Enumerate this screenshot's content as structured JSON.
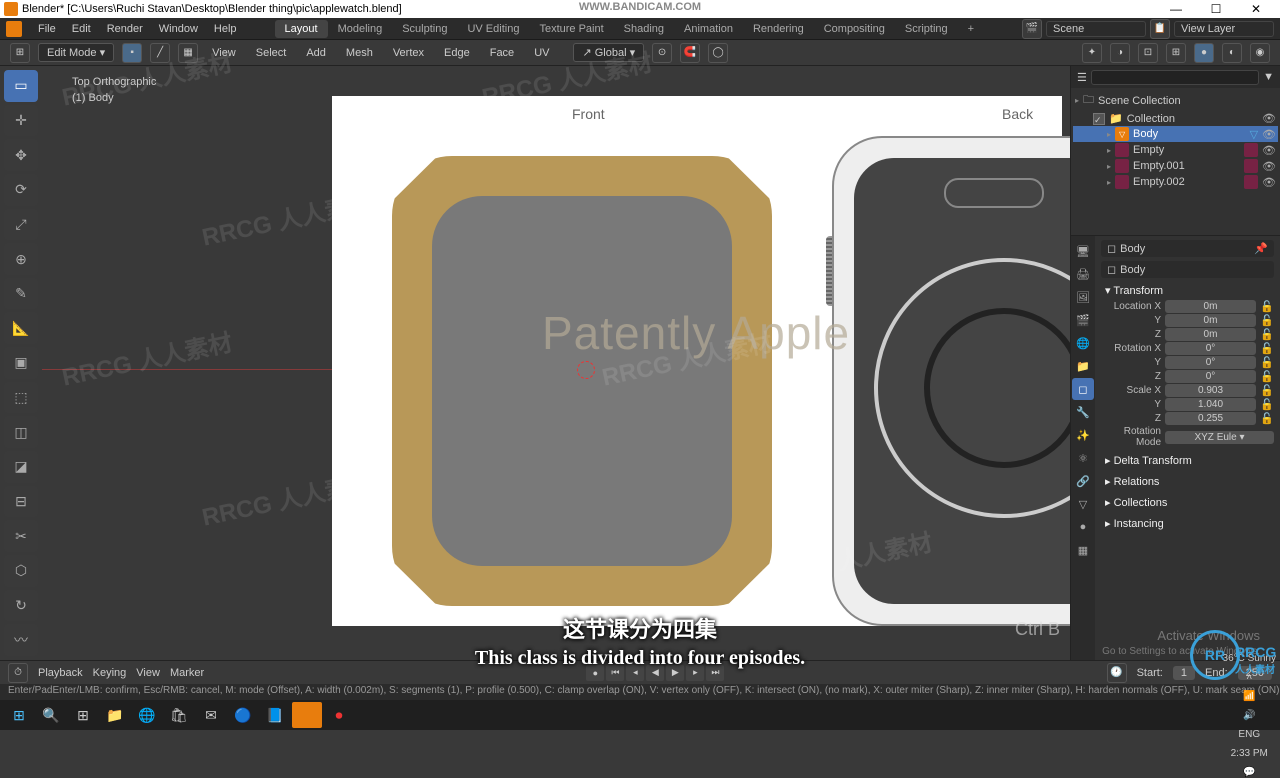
{
  "titlebar": {
    "app_title": "Blender* [C:\\Users\\Ruchi Stavan\\Desktop\\Blender thing\\pic\\applewatch.blend]",
    "bandicam": "WWW.BANDICAM.COM"
  },
  "menubar": {
    "items": [
      "File",
      "Edit",
      "Render",
      "Window",
      "Help"
    ],
    "tabs": [
      "Layout",
      "Modeling",
      "Sculpting",
      "UV Editing",
      "Texture Paint",
      "Shading",
      "Animation",
      "Rendering",
      "Compositing",
      "Scripting"
    ],
    "active_tab": "Layout",
    "scene_icon_label": "Scene",
    "viewlayer_label": "View Layer"
  },
  "toolbar2": {
    "mode": "Edit Mode",
    "menus": [
      "View",
      "Select",
      "Add",
      "Mesh",
      "Vertex",
      "Edge",
      "Face",
      "UV"
    ],
    "orientation": "Global"
  },
  "viewport": {
    "view_name": "Top Orthographic",
    "object_name": "(1) Body",
    "ref_front": "Front",
    "ref_back": "Back",
    "watermark_text": "Patently Apple",
    "shortcut_hint": "Ctrl B"
  },
  "outliner": {
    "root": "Scene Collection",
    "collection": "Collection",
    "items": [
      {
        "name": "Body",
        "active": true
      },
      {
        "name": "Empty",
        "active": false
      },
      {
        "name": "Empty.001",
        "active": false
      },
      {
        "name": "Empty.002",
        "active": false
      }
    ]
  },
  "properties": {
    "header1": "Body",
    "header2": "Body",
    "panel_transform": "Transform",
    "loc": {
      "x_label": "Location X",
      "y_label": "Y",
      "z_label": "Z",
      "x": "0m",
      "y": "0m",
      "z": "0m"
    },
    "rot": {
      "x_label": "Rotation X",
      "y_label": "Y",
      "z_label": "Z",
      "x": "0°",
      "y": "0°",
      "z": "0°"
    },
    "scale": {
      "x_label": "Scale X",
      "y_label": "Y",
      "z_label": "Z",
      "x": "0.903",
      "y": "1.040",
      "z": "0.255"
    },
    "rot_mode_label": "Rotation Mode",
    "rot_mode_value": "XYZ Eule",
    "panels": [
      "Delta Transform",
      "Relations",
      "Collections",
      "Instancing"
    ]
  },
  "timeline": {
    "menu": [
      "Playback",
      "Keying",
      "View",
      "Marker"
    ],
    "start_label": "Start:",
    "start": "1",
    "end_label": "End:",
    "end": "250"
  },
  "status": "Enter/PadEnter/LMB: confirm, Esc/RMB: cancel, M: mode (Offset), A: width (0.002m), S: segments (1), P: profile (0.500), C: clamp overlap (ON), V: vertex only (OFF), K: intersect (ON), (no mark), X: outer miter (Sharp), Z: inner miter (Sharp), H: harden normals (OFF), U: mark seam (ON)",
  "taskbar": {
    "temp": "36°C",
    "weather": "Sunny",
    "time": "2:33 PM",
    "date": "",
    "lang": "ENG",
    "net": "wifi"
  },
  "subtitles": {
    "zh": "这节课分为四集",
    "en": "This class is divided into four episodes."
  },
  "activate": {
    "line1": "Activate Windows",
    "line2": "Go to Settings to activate Windows."
  },
  "rrcg": {
    "logo": "RR",
    "text": "RRCG\n人人素材"
  },
  "watermarks": "RRCG 人人素材"
}
